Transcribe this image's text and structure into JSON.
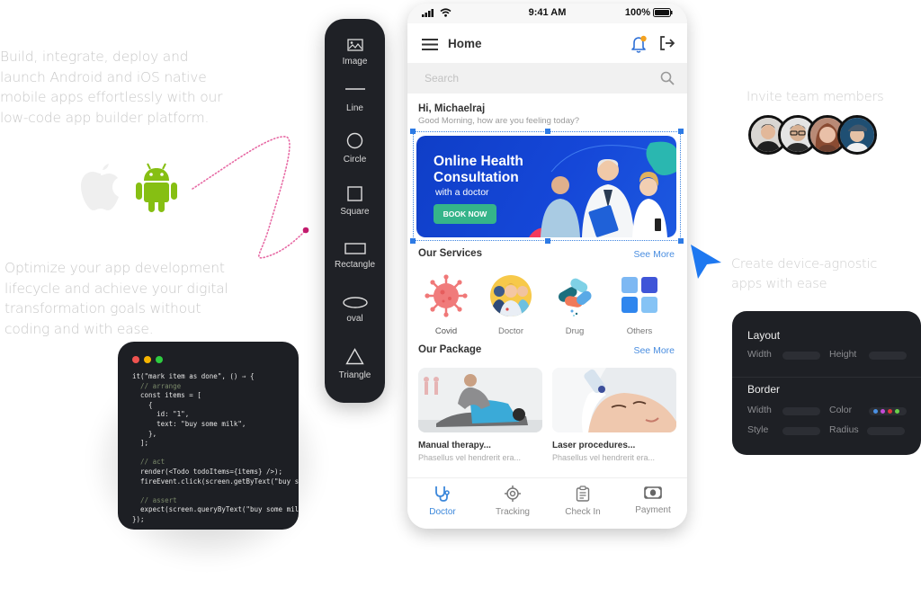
{
  "marketing": {
    "lead_1": "Build, integrate, deploy and launch Android and iOS native mobile apps effortlessly with our low-code app builder platform.",
    "lead_2": "Optimize your app development lifecycle and achieve your digital transformation goals without coding and with ease.",
    "invite": "Invite team members",
    "device_agnostic": "Create device-agnostic apps with ease",
    "platforms": [
      "apple-icon",
      "android-icon"
    ]
  },
  "code_editor": {
    "window_dots": [
      "#ef5350",
      "#f5b400",
      "#2ecc40"
    ],
    "lines": [
      {
        "t": "it(\"mark item as done\", () ⇒ {",
        "c": ""
      },
      {
        "t": "  // arrange",
        "c": "cm"
      },
      {
        "t": "  const items = [",
        "c": ""
      },
      {
        "t": "    {",
        "c": ""
      },
      {
        "t": "      id: \"1\",",
        "c": ""
      },
      {
        "t": "      text: \"buy some milk\",",
        "c": ""
      },
      {
        "t": "    },",
        "c": ""
      },
      {
        "t": "  ];",
        "c": ""
      },
      {
        "t": "",
        "c": ""
      },
      {
        "t": "  // act",
        "c": "cm"
      },
      {
        "t": "  render(<Todo todoItems={items} />);",
        "c": ""
      },
      {
        "t": "  fireEvent.click(screen.getByText(\"buy s",
        "c": ""
      },
      {
        "t": "",
        "c": ""
      },
      {
        "t": "  // assert",
        "c": "cm"
      },
      {
        "t": "  expect(screen.queryByText(\"buy some mil",
        "c": ""
      },
      {
        "t": "});",
        "c": ""
      }
    ]
  },
  "palette": {
    "tools": [
      {
        "label": "Image",
        "icon": "image-icon"
      },
      {
        "label": "Line",
        "icon": "line-icon"
      },
      {
        "label": "Circle",
        "icon": "circle-icon"
      },
      {
        "label": "Square",
        "icon": "square-icon"
      },
      {
        "label": "Rectangle",
        "icon": "rectangle-icon"
      },
      {
        "label": "oval",
        "icon": "oval-icon"
      },
      {
        "label": "Triangle",
        "icon": "triangle-icon"
      }
    ]
  },
  "phone": {
    "status": {
      "time": "9:41 AM",
      "battery": "100%"
    },
    "appbar": {
      "title": "Home"
    },
    "search": {
      "placeholder": "Search"
    },
    "greeting": {
      "title": "Hi, Michaelraj",
      "subtitle": "Good Morning, how are you feeling today?"
    },
    "banner": {
      "title": "Online Health Consultation",
      "subtitle": "with a doctor",
      "button": "BOOK NOW"
    },
    "services": {
      "heading": "Our Services",
      "see_more": "See More",
      "items": [
        {
          "label": "Covid",
          "icon": "virus-icon"
        },
        {
          "label": "Doctor",
          "icon": "doctors-icon"
        },
        {
          "label": "Drug",
          "icon": "pills-icon"
        },
        {
          "label": "Others",
          "icon": "grid-icon"
        }
      ]
    },
    "packages": {
      "heading": "Our Package",
      "see_more": "See More",
      "items": [
        {
          "title": "Manual therapy...",
          "subtitle": "Phasellus vel hendrerit era..."
        },
        {
          "title": "Laser procedures...",
          "subtitle": "Phasellus vel hendrerit era..."
        }
      ]
    },
    "tabs": [
      {
        "label": "Doctor",
        "icon": "stethoscope-icon",
        "active": true
      },
      {
        "label": "Tracking",
        "icon": "target-icon",
        "active": false
      },
      {
        "label": "Check In",
        "icon": "clipboard-icon",
        "active": false
      },
      {
        "label": "Payment",
        "icon": "cash-icon",
        "active": false
      }
    ],
    "colors": {
      "accent": "#3c88db",
      "banner": "#1547d8",
      "button": "#35b48a",
      "selection": "#2e7be5"
    }
  },
  "properties_panel": {
    "layout": {
      "heading": "Layout",
      "width": "Width",
      "height": "Height"
    },
    "border": {
      "heading": "Border",
      "width": "Width",
      "color": "Color",
      "style": "Style",
      "radius": "Radius"
    },
    "swatches": [
      "#4a90e2",
      "#c64bd6",
      "#e0363c",
      "#6ad04a"
    ]
  }
}
